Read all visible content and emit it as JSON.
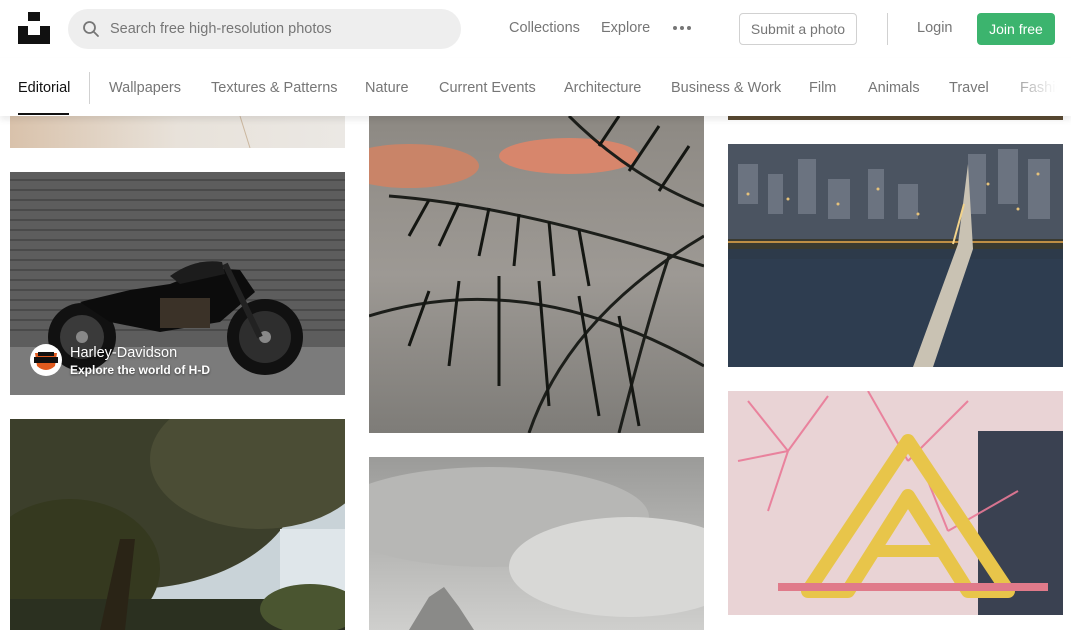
{
  "header": {
    "search_placeholder": "Search free high-resolution photos",
    "nav": [
      "Collections",
      "Explore"
    ],
    "submit_label": "Submit a photo",
    "login_label": "Login",
    "join_label": "Join free",
    "join_color": "#3cb46e"
  },
  "topics": {
    "active": "Editorial",
    "items": [
      "Wallpapers",
      "Textures & Patterns",
      "Nature",
      "Current Events",
      "Architecture",
      "Business & Work",
      "Film",
      "Animals",
      "Travel",
      "Fashion"
    ]
  },
  "photos": {
    "sponsored": {
      "name": "Harley-Davidson",
      "tagline": "Explore the world of H-D"
    }
  }
}
